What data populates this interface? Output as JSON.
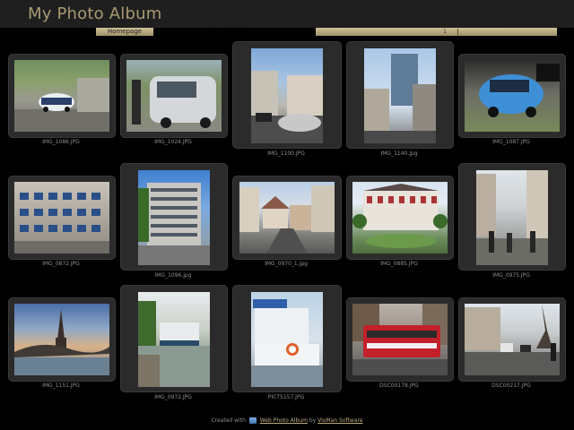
{
  "header": {
    "title": "My Photo Album",
    "home_label": "Homepage",
    "page_number": "1"
  },
  "photos": [
    {
      "caption": "IMG_1086.JPG"
    },
    {
      "caption": "IMG_1024.JPG"
    },
    {
      "caption": "IMG_1100.JPG"
    },
    {
      "caption": "IMG_1140.jpg"
    },
    {
      "caption": "IMG_1087.JPG"
    },
    {
      "caption": "IMG_0872.JPG"
    },
    {
      "caption": "IMG_1096.jpg"
    },
    {
      "caption": "IMG_0970_1.jpg"
    },
    {
      "caption": "IMG_0885.JPG"
    },
    {
      "caption": "IMG_0975.JPG"
    },
    {
      "caption": "IMG_1151.JPG"
    },
    {
      "caption": "IMG_0972.JPG"
    },
    {
      "caption": "PICT5157.JPG"
    },
    {
      "caption": "DSC00178.JPG"
    },
    {
      "caption": "DSC00217.JPG"
    }
  ],
  "footer": {
    "created_with": "Created with",
    "app_link": "Web Photo Album",
    "by": "by",
    "vendor_link": "VioMan Software"
  }
}
